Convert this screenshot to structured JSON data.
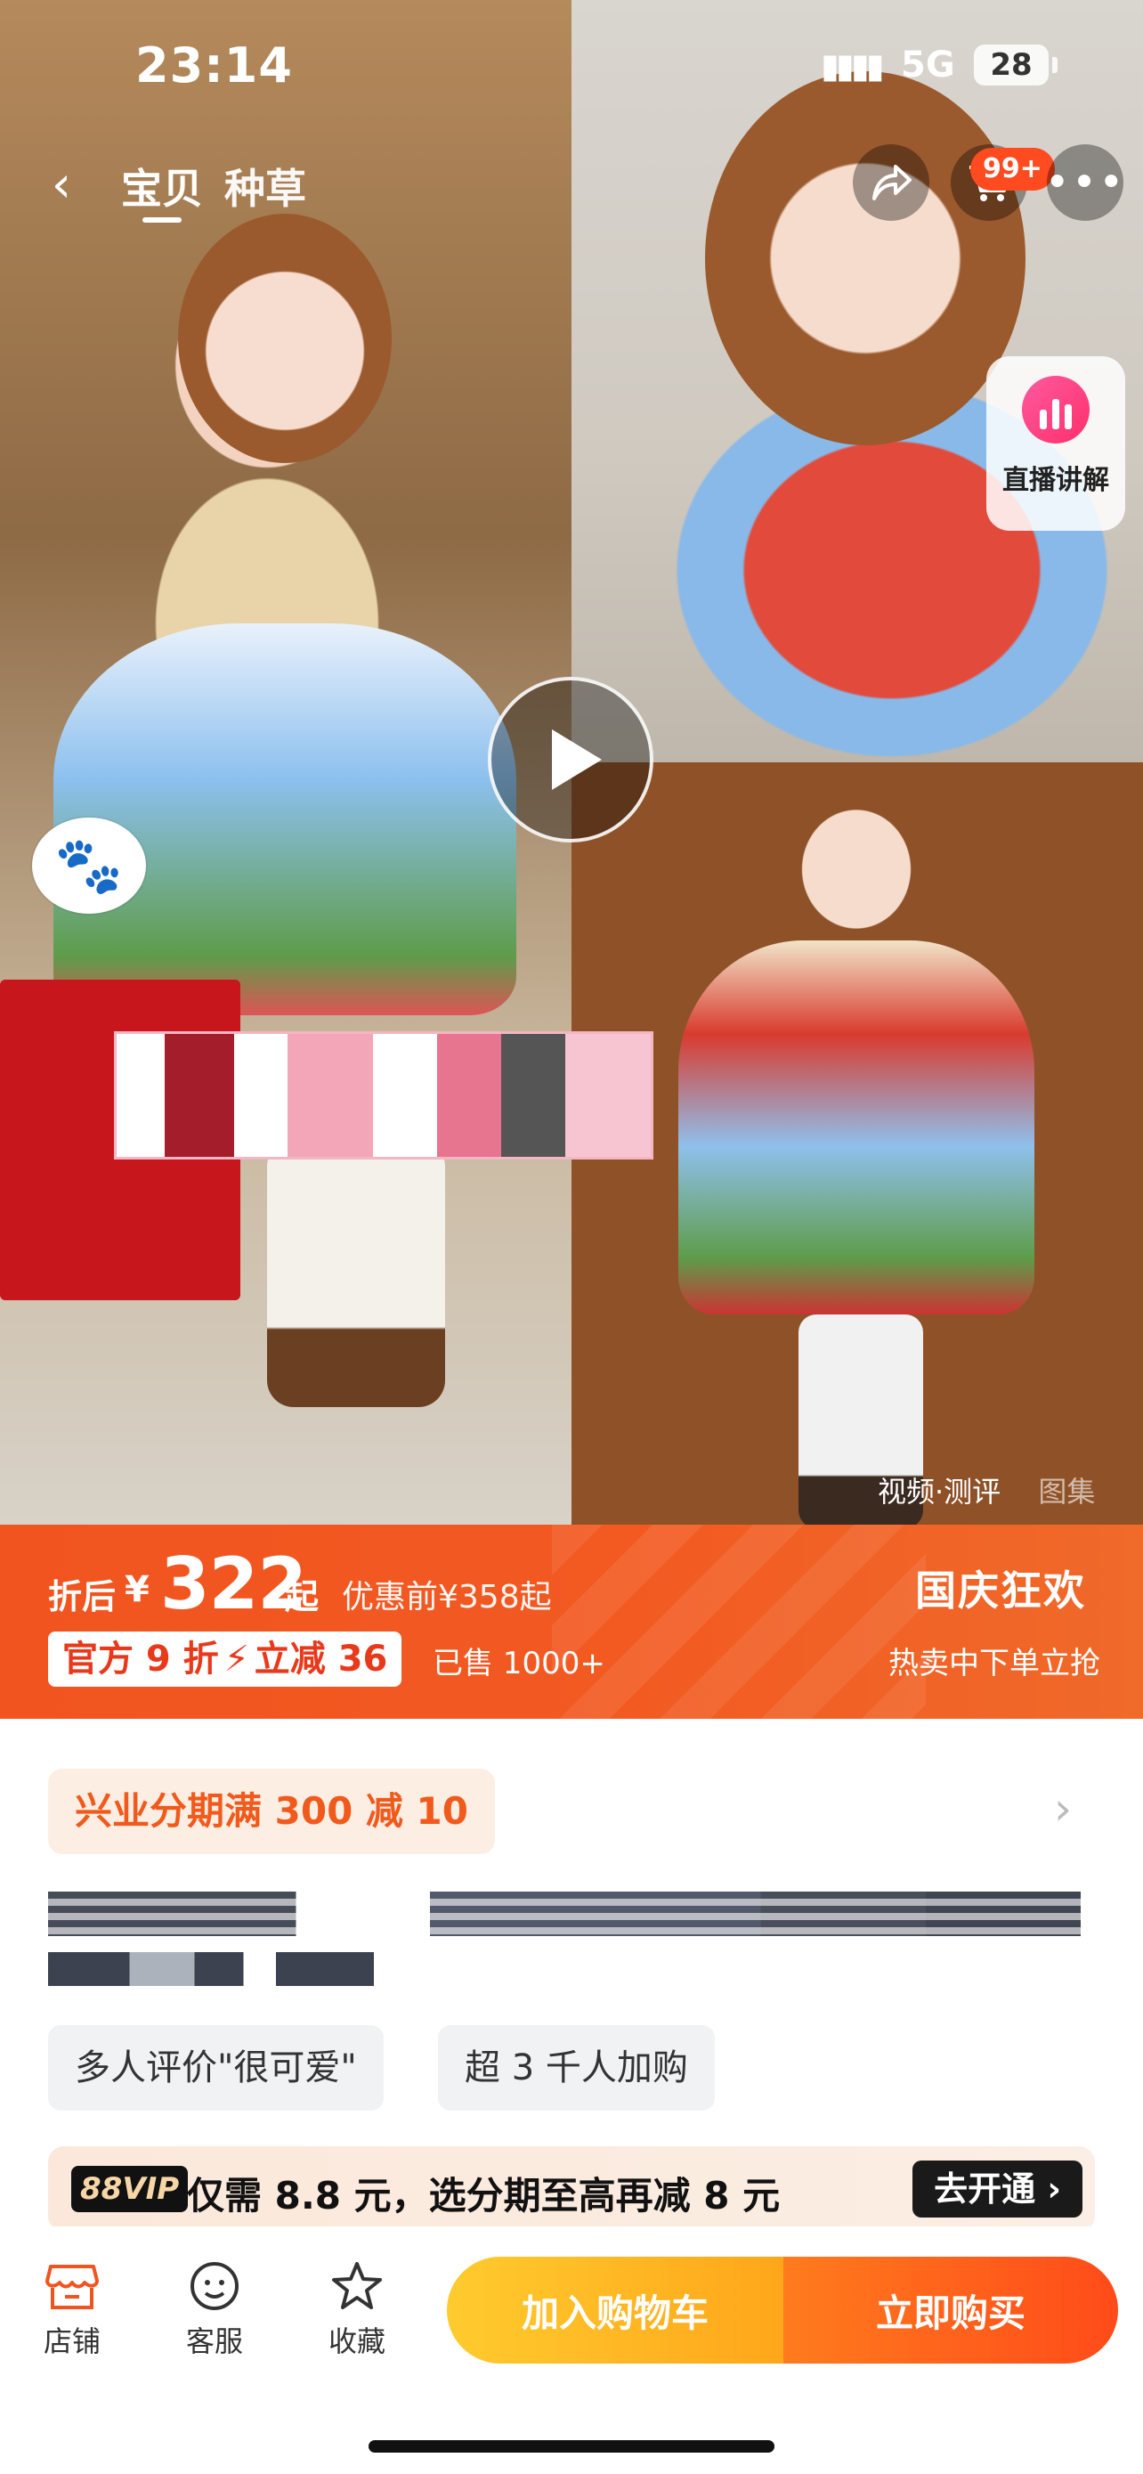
{
  "status_bar": {
    "time": "23:14",
    "network": "5G",
    "battery": "28"
  },
  "nav": {
    "tabs": [
      {
        "label": "宝贝"
      },
      {
        "label": "种草"
      }
    ],
    "cart_badge": "99+"
  },
  "media": {
    "live_label": "直播讲解",
    "tabs": [
      {
        "label": "视频·测评"
      },
      {
        "label": "图集"
      }
    ]
  },
  "price": {
    "after_label": "折后",
    "currency": "¥",
    "amount": "322",
    "from": "起",
    "original": "优惠前¥358起",
    "coupon_official": "官方 9 折",
    "coupon_bolt": "⚡",
    "coupon_discount": "立减 36",
    "sold": "已售 1000+",
    "event_title": "国庆狂欢",
    "event_sub": "热卖中下单立抢"
  },
  "info": {
    "installment": "兴业分期满 300 减 10",
    "tags": [
      "多人评价\"很可爱\"",
      "超 3 千人加购"
    ],
    "vip": {
      "badge": "88VIP",
      "text": "仅需 8.8 元，选分期至高再减 8 元",
      "button": "去开通 ›"
    }
  },
  "bottom_bar": {
    "store": "店铺",
    "service": "客服",
    "favorite": "收藏",
    "add_to_cart": "加入购物车",
    "buy_now": "立即购买"
  },
  "colors": {
    "accent_orange": "#f1541f",
    "badge_red": "#ff4b1f",
    "cta_yellow": "#ffb220",
    "cta_orange": "#ff5a1b"
  }
}
